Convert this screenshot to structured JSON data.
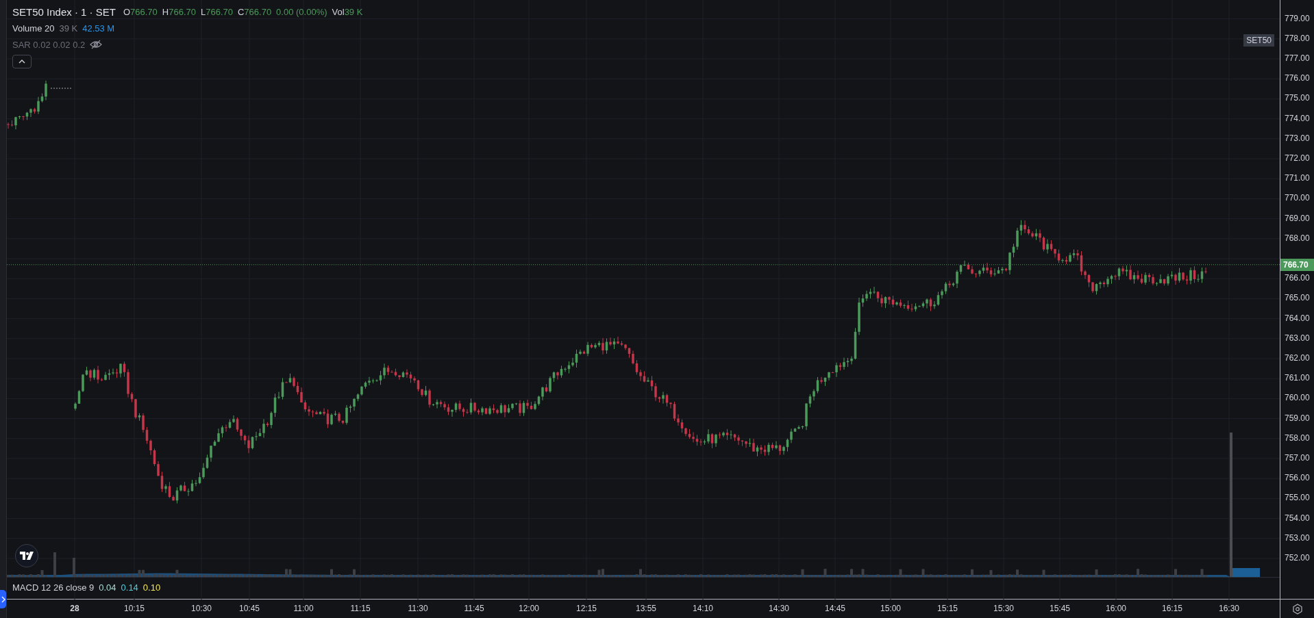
{
  "legend": {
    "title": "SET50 Index · 1 · SET",
    "ohlc": [
      {
        "label": "O",
        "value": "766.70"
      },
      {
        "label": "H",
        "value": "766.70"
      },
      {
        "label": "L",
        "value": "766.70"
      },
      {
        "label": "C",
        "value": "766.70"
      }
    ],
    "change": "0.00 (0.00%)",
    "volume": {
      "label": "Vol",
      "value": "39 K"
    }
  },
  "indicators": [
    {
      "name": "Volume 20",
      "hidden": false,
      "values": [
        {
          "text": "39 K",
          "color": "#787b86"
        },
        {
          "text": "42.53 M",
          "color": "#2196f3"
        }
      ]
    },
    {
      "name": "SAR 0.02 0.02 0.2",
      "hidden": true
    }
  ],
  "macd": {
    "name": "MACD 12 26 close 9",
    "values": [
      {
        "text": "0.04",
        "color": "#a8dcd6"
      },
      {
        "text": "0.14",
        "color": "#4dd0e1"
      },
      {
        "text": "0.10",
        "color": "#f5e65c"
      }
    ]
  },
  "symbol_tag": "SET50",
  "price_axis": {
    "labels": [
      "779.00",
      "778.00",
      "777.00",
      "776.00",
      "775.00",
      "774.00",
      "773.00",
      "772.00",
      "771.00",
      "770.00",
      "769.00",
      "768.00",
      "766.00",
      "765.00",
      "764.00",
      "763.00",
      "762.00",
      "761.00",
      "760.00",
      "759.00",
      "758.00",
      "757.00",
      "756.00",
      "755.00",
      "754.00",
      "753.00",
      "752.00"
    ],
    "last_price": "766.70"
  },
  "time_axis": {
    "labels": [
      "28",
      "10:15",
      "10:30",
      "10:45",
      "11:00",
      "11:15",
      "11:30",
      "11:45",
      "12:00",
      "12:15",
      "13:55",
      "14:10",
      "14:30",
      "14:45",
      "15:00",
      "15:15",
      "15:30",
      "15:45",
      "16:00",
      "16:15",
      "16:30"
    ]
  }
}
